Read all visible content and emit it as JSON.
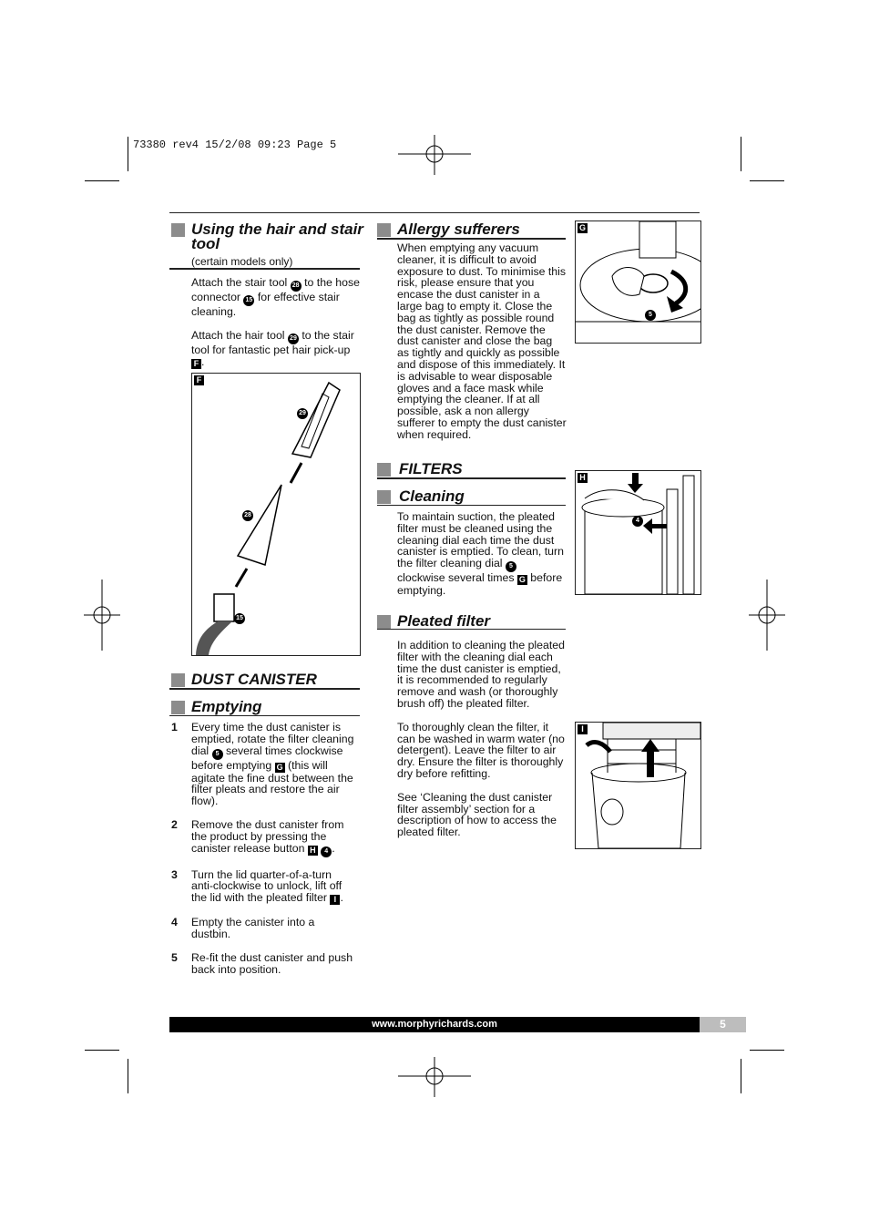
{
  "slug": "73380 rev4  15/2/08  09:23  Page 5",
  "hair_tool": {
    "title": "Using the hair and stair tool",
    "subtitle": "(certain models only)",
    "paragraphs": [
      [
        {
          "t": "Attach the stair tool "
        },
        {
          "c": "28"
        },
        {
          "t": " to the hose connector "
        },
        {
          "c": "15"
        },
        {
          "t": " for effective stair cleaning."
        }
      ],
      [
        {
          "t": "Attach the hair tool "
        },
        {
          "c": "29"
        },
        {
          "t": " to the stair tool for fantastic pet hair pick-up "
        },
        {
          "b": "F"
        },
        {
          "t": "."
        }
      ]
    ]
  },
  "figures": {
    "F": {
      "label": "F",
      "callouts": [
        "29",
        "28",
        "15"
      ]
    },
    "G": {
      "label": "G",
      "callouts": [
        "5"
      ]
    },
    "H": {
      "label": "H",
      "callouts": [
        "4"
      ]
    },
    "I": {
      "label": "I"
    }
  },
  "dust_canister": {
    "title": "DUST CANISTER",
    "subtitle": "Emptying",
    "steps": [
      {
        "n": "1",
        "parts": [
          {
            "t": "Every time the dust canister is emptied, rotate the filter cleaning dial "
          },
          {
            "c": "5"
          },
          {
            "t": " several times clockwise before emptying "
          },
          {
            "b": "G"
          },
          {
            "t": " (this will agitate the fine dust between the filter pleats and restore the air flow)."
          }
        ]
      },
      {
        "n": "2",
        "parts": [
          {
            "t": "Remove the dust canister from the product by pressing the canister release button "
          },
          {
            "b": "H"
          },
          {
            "t": " "
          },
          {
            "c": "4"
          },
          {
            "t": "."
          }
        ]
      },
      {
        "n": "3",
        "parts": [
          {
            "t": "Turn the lid quarter-of-a-turn anti-clockwise to unlock, lift off the lid with the pleated filter "
          },
          {
            "b": "I"
          },
          {
            "t": "."
          }
        ]
      },
      {
        "n": "4",
        "parts": [
          {
            "t": "Empty the canister into a dustbin."
          }
        ]
      },
      {
        "n": "5",
        "parts": [
          {
            "t": "Re-fit the dust canister and push back into position."
          }
        ]
      }
    ]
  },
  "allergy": {
    "title": "Allergy sufferers",
    "paragraphs": [
      [
        {
          "t": "When emptying any vacuum cleaner, it is difficult to avoid exposure to dust. To minimise this risk, please ensure that you encase the dust canister in a large bag to empty it. Close the bag as tightly as possible round the dust canister. Remove the dust canister and close the bag as tightly and quickly as possible and dispose of this immediately. It is advisable to wear disposable gloves and a face mask while emptying the cleaner. If at all possible, ask a non allergy sufferer to empty the dust canister when required."
        }
      ]
    ]
  },
  "filters": {
    "title": "FILTERS",
    "cleaning_title": "Cleaning",
    "cleaning": [
      [
        {
          "t": "To maintain suction, the pleated filter must be cleaned using the cleaning dial each time the dust canister is emptied. To clean, turn the filter cleaning dial "
        },
        {
          "c": "5"
        },
        {
          "t": " clockwise several times "
        },
        {
          "b": "G"
        },
        {
          "t": " before emptying."
        }
      ]
    ],
    "pleated_title": "Pleated filter",
    "pleated": [
      [
        {
          "t": "In addition to cleaning the pleated filter with the cleaning dial each time the dust canister is emptied, it is recommended to regularly remove and wash (or thoroughly brush off) the pleated filter."
        }
      ],
      [
        {
          "t": "To thoroughly clean the filter, it can be washed in warm water (no detergent). Leave the filter to air dry. Ensure the filter is thoroughly dry before refitting."
        }
      ],
      [
        {
          "t": "See ‘Cleaning the dust canister filter assembly’ section for a description of how to access the pleated filter."
        }
      ]
    ]
  },
  "footer": {
    "url": "www.morphyrichards.com",
    "page": "5"
  }
}
